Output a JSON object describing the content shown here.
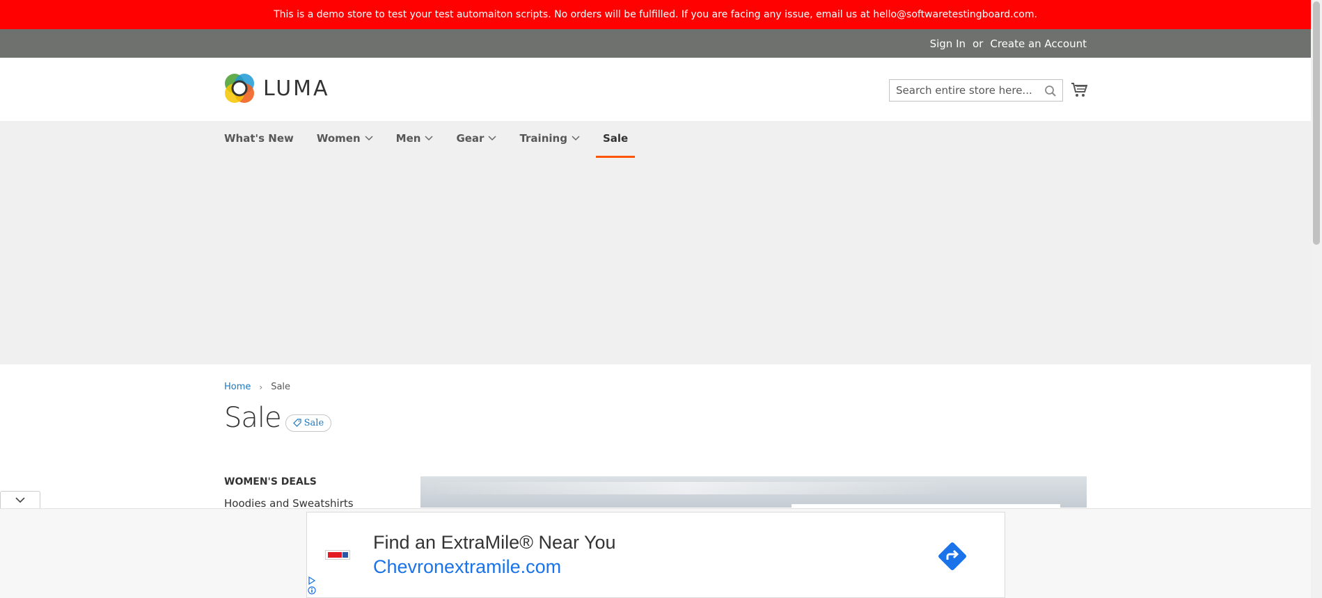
{
  "demo_banner": {
    "text": "This is a demo store to test your test automaiton scripts. No orders will be fulfilled. If you are facing any issue, email us at hello@softwaretestingboard.com."
  },
  "top_links": {
    "sign_in": "Sign In",
    "or": "or",
    "create_account": "Create an Account"
  },
  "header": {
    "logo_text": "LUMA",
    "search_placeholder": "Search entire store here...",
    "colors": {
      "logo_orange": "#f26322",
      "logo_green": "#5ba844",
      "logo_blue": "#1d9ad6",
      "logo_yellow": "#f5c600"
    }
  },
  "nav": {
    "items": [
      {
        "label": "What's New",
        "has_dropdown": false
      },
      {
        "label": "Women",
        "has_dropdown": true
      },
      {
        "label": "Men",
        "has_dropdown": true
      },
      {
        "label": "Gear",
        "has_dropdown": true
      },
      {
        "label": "Training",
        "has_dropdown": true
      },
      {
        "label": "Sale",
        "has_dropdown": false,
        "active": true
      }
    ],
    "active_color": "#ff5501"
  },
  "breadcrumbs": {
    "home": "Home",
    "separator": "›",
    "current": "Sale"
  },
  "page": {
    "title": "Sale",
    "tag_label": "Sale"
  },
  "sidebar": {
    "heading": "WOMEN'S DEALS",
    "links": [
      "Hoodies and Sweatshirts"
    ]
  },
  "ad": {
    "title": "Find an ExtraMile® Near You",
    "url": "Chevronextramile.com",
    "cta_color": "#1a73e8"
  },
  "colors": {
    "banner_red": "#ff0101",
    "top_bar_gray": "#6e716e",
    "link_blue": "#1979c3"
  }
}
